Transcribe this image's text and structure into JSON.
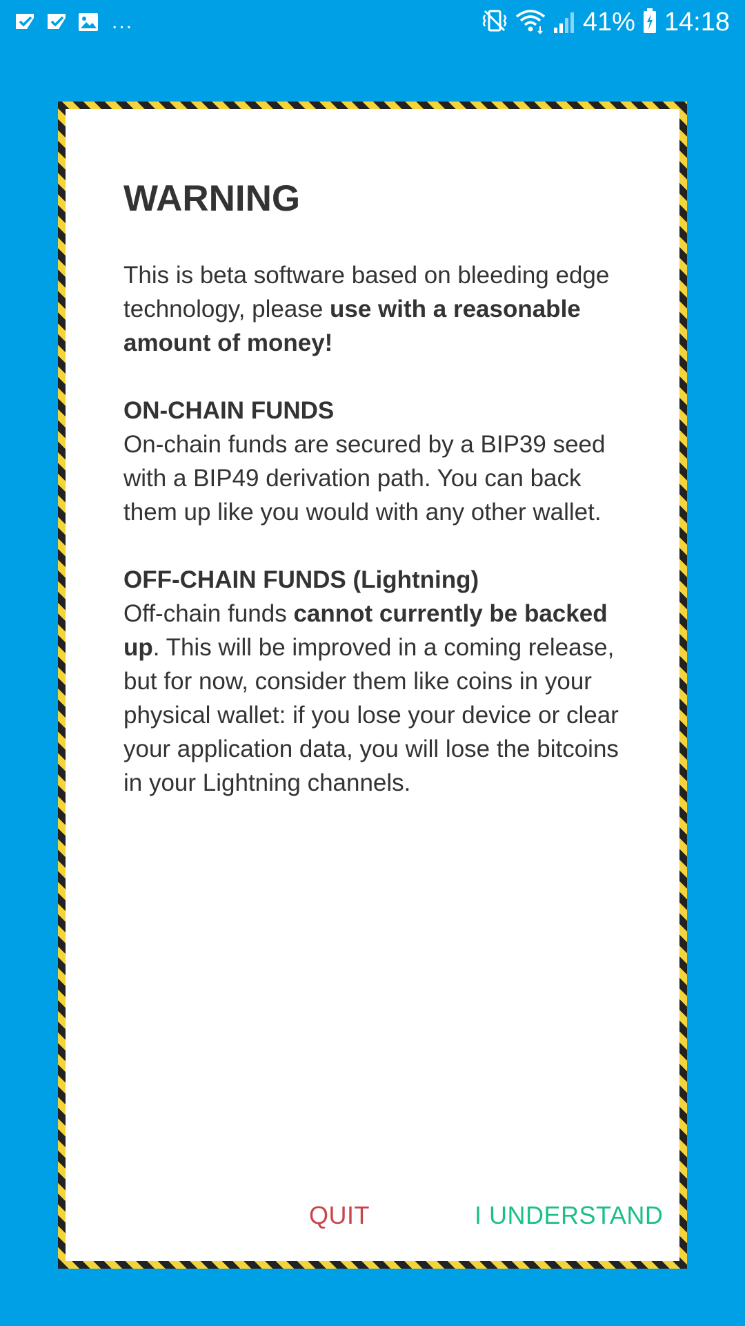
{
  "status_bar": {
    "left_icons": [
      "check-notification-icon",
      "check-notification-icon",
      "image-notification-icon"
    ],
    "more_indicator": "...",
    "right_icons": [
      "vibrate-mute-icon",
      "wifi-icon",
      "signal-icon",
      "battery-charging-icon"
    ],
    "battery": "41%",
    "time": "14:18"
  },
  "dialog": {
    "title": "WARNING",
    "intro": {
      "text": "This is beta software based on bleeding edge technology, please ",
      "bold": "use with a reasonable amount of money!"
    },
    "onchain": {
      "heading": "ON-CHAIN FUNDS",
      "body": "On-chain funds are secured by a BIP39 seed with a BIP49 derivation path. You can back them up like you would with any other wallet."
    },
    "offchain": {
      "heading": "OFF-CHAIN FUNDS (Lightning)",
      "body_prefix": "Off-chain funds ",
      "bold": "cannot currently be backed up",
      "body_suffix": ". This will be improved in a coming release, but for now, consider them like coins in your physical wallet: if you lose your device or clear your application data, you will lose the bitcoins in your Lightning channels."
    },
    "buttons": {
      "quit": "QUIT",
      "understand": "I UNDERSTAND"
    }
  },
  "colors": {
    "background": "#00a0e6",
    "quit": "#c9454a",
    "understand": "#1bbf8a",
    "stripe_dark": "#222222",
    "stripe_yellow": "#f5d33a"
  }
}
